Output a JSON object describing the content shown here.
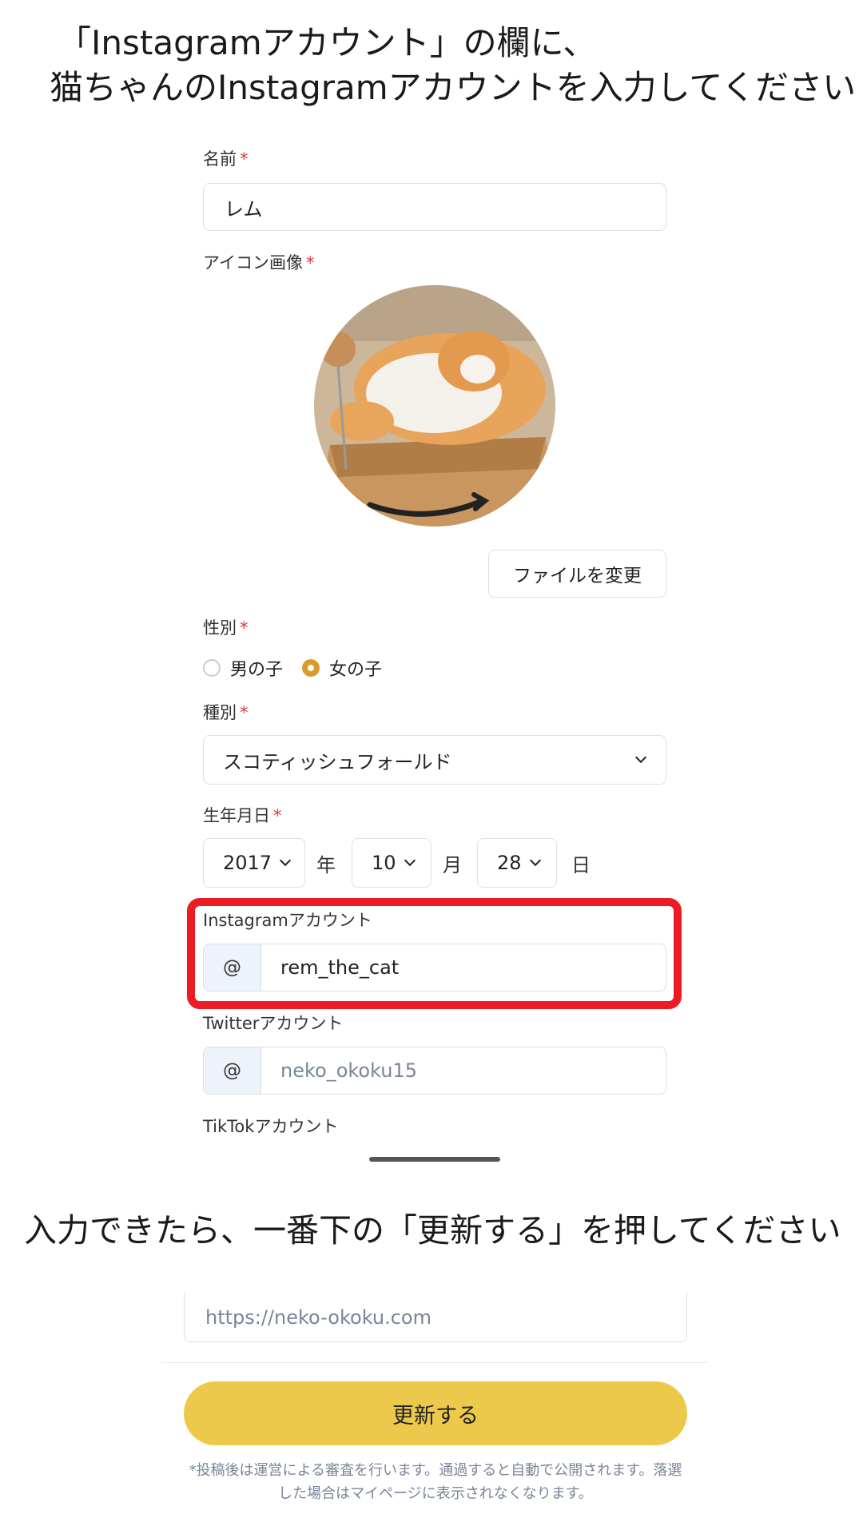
{
  "instructions": {
    "line1": "「Instagramアカウント」の欄に、",
    "line2": "猫ちゃんのInstagramアカウントを入力してください",
    "line3": "入力できたら、一番下の「更新する」を押してください"
  },
  "form": {
    "name": {
      "label": "名前",
      "required_mark": "*",
      "value": "レム"
    },
    "icon": {
      "label": "アイコン画像",
      "required_mark": "*",
      "change_button": "ファイルを変更"
    },
    "gender": {
      "label": "性別",
      "required_mark": "*",
      "options": [
        {
          "label": "男の子",
          "selected": false
        },
        {
          "label": "女の子",
          "selected": true
        }
      ]
    },
    "breed": {
      "label": "種別",
      "required_mark": "*",
      "value": "スコティッシュフォールド"
    },
    "birthday": {
      "label": "生年月日",
      "required_mark": "*",
      "year": "2017",
      "year_unit": "年",
      "month": "10",
      "month_unit": "月",
      "day": "28",
      "day_unit": "日"
    },
    "instagram": {
      "label": "Instagramアカウント",
      "prefix": "@",
      "value": "rem_the_cat"
    },
    "twitter": {
      "label": "Twitterアカウント",
      "prefix": "@",
      "placeholder": "neko_okoku15"
    },
    "tiktok": {
      "label": "TikTokアカウント"
    },
    "website": {
      "placeholder": "https://neko-okoku.com"
    },
    "submit_label": "更新する",
    "note": "*投稿後は運営による審査を行います。通過すると自動で公開されます。落選した場合はマイページに表示されなくなります。"
  },
  "colors": {
    "accent_yellow": "#ecc94b",
    "radio_selected": "#d99a2b",
    "highlight_red": "#ec1c24",
    "required_red": "#d9383a"
  }
}
